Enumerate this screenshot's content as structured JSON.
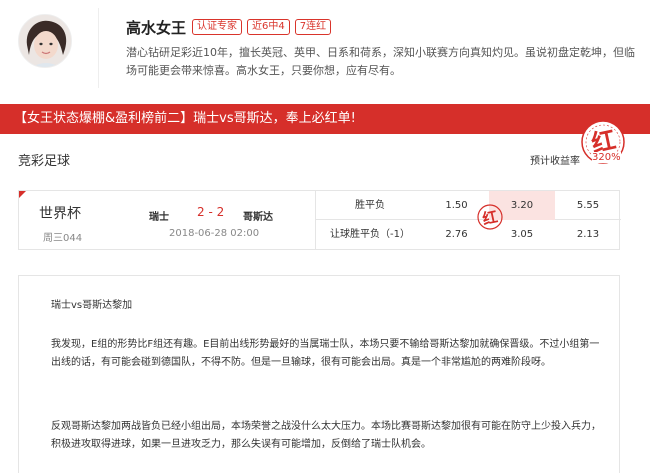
{
  "expert": {
    "name": "高水女王",
    "badges": [
      "认证专家",
      "近6中4",
      "7连红"
    ],
    "bio": "潜心钻研足彩近10年，擅长英冠、英甲、日系和荷系，深知小联赛方向真知灼见。虽说初盘定乾坤，但临场可能更会带来惊喜。高水女王，只要你想，应有尽有。"
  },
  "banner": {
    "text": "【女王状态爆棚&盈利榜前二】瑞士vs哥斯达，奉上必红单!"
  },
  "stamp": {
    "char": "红",
    "yield_value": "320%"
  },
  "section": {
    "title": "竞彩足球"
  },
  "yield": {
    "label": "预计收益率"
  },
  "match": {
    "league": "世界杯",
    "number": "周三044",
    "home": "瑞士",
    "score": "2 - 2",
    "away": "哥斯达",
    "time": "2018-06-28 02:00",
    "odds": [
      {
        "label": "胜平负",
        "values": [
          "1.50",
          "3.20",
          "5.55"
        ]
      },
      {
        "label": "让球胜平负（-1）",
        "values": [
          "2.76",
          "3.05",
          "2.13"
        ]
      }
    ],
    "mini_stamp": "红"
  },
  "article": {
    "title": "瑞士vs哥斯达黎加",
    "paragraphs": [
      "我发现，E组的形势比F组还有趣。E目前出线形势最好的当属瑞士队，本场只要不输给哥斯达黎加就确保晋级。不过小组第一出线的话，有可能会碰到德国队，不得不防。但是一旦输球，很有可能会出局。真是一个非常尴尬的两难阶段呀。",
      "反观哥斯达黎加两战皆负已经小组出局，本场荣誉之战没什么太大压力。本场比赛哥斯达黎加很有可能在防守上少投入兵力，积极进攻取得进球，如果一旦进攻乏力，那么失误有可能增加，反倒给了瑞士队机会。"
    ]
  },
  "colors": {
    "accent": "#d62f2a",
    "highlight": "#fbe3e1"
  }
}
